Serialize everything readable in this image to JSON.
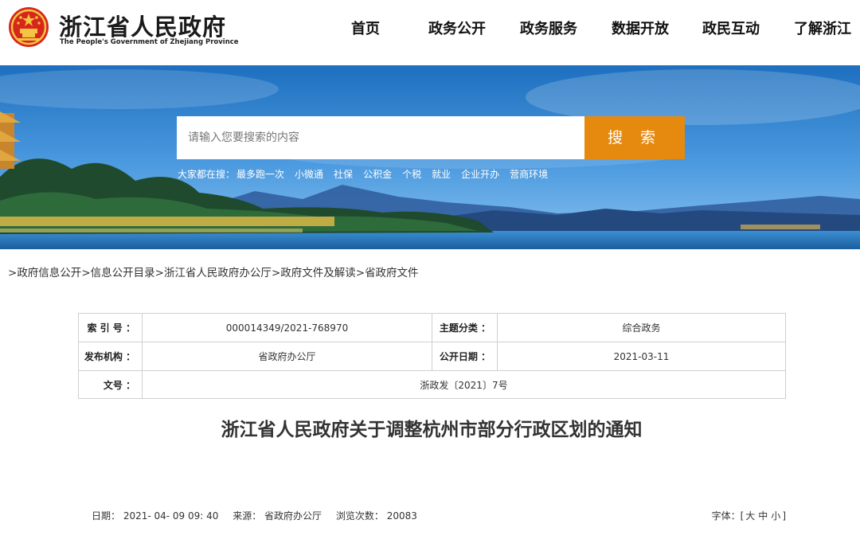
{
  "header": {
    "title": "浙江省人民政府",
    "subtitle": "The People's Government of Zhejiang Province"
  },
  "nav": [
    {
      "label": "首页"
    },
    {
      "label": "政务公开"
    },
    {
      "label": "政务服务"
    },
    {
      "label": "数据开放"
    },
    {
      "label": "政民互动"
    },
    {
      "label": "了解浙江"
    }
  ],
  "search": {
    "placeholder": "请输入您要搜索的内容",
    "button": "搜 索",
    "hot_label": "大家都在搜：",
    "hot_links": [
      "最多跑一次",
      "小微通",
      "社保",
      "公积金",
      "个税",
      "就业",
      "企业开办",
      "营商环境"
    ]
  },
  "breadcrumb": [
    {
      "sep": ">",
      "label": "政府信息公开"
    },
    {
      "sep": ">",
      "label": "信息公开目录"
    },
    {
      "sep": ">",
      "label": "浙江省人民政府办公厅"
    },
    {
      "sep": ">",
      "label": "政府文件及解读"
    },
    {
      "sep": ">",
      "label": "省政府文件"
    }
  ],
  "info": {
    "index_label": "索 引 号 ：",
    "index_value": "000014349/2021-768970",
    "topic_label": "主题分类 ：",
    "topic_value": "综合政务",
    "issuer_label": "发布机构 ：",
    "issuer_value": "省政府办公厅",
    "date_label": "公开日期 ：",
    "date_value": "2021-03-11",
    "docno_label": "文号 ：",
    "docno_value": "浙政发〔2021〕7号"
  },
  "doc": {
    "title": "浙江省人民政府关于调整杭州市部分行政区划的通知"
  },
  "meta": {
    "date": "日期： 2021- 04- 09 09: 40",
    "source": "来源： 省政府办公厅",
    "views": "浏览次数： 20083"
  },
  "fontsize": {
    "label": "字体：[",
    "large": "大",
    "medium": "中",
    "small": "小",
    "close": "]"
  },
  "colors": {
    "accent": "#e68a0f",
    "emblem": "#d7261c",
    "sky": "#1f76c4"
  }
}
